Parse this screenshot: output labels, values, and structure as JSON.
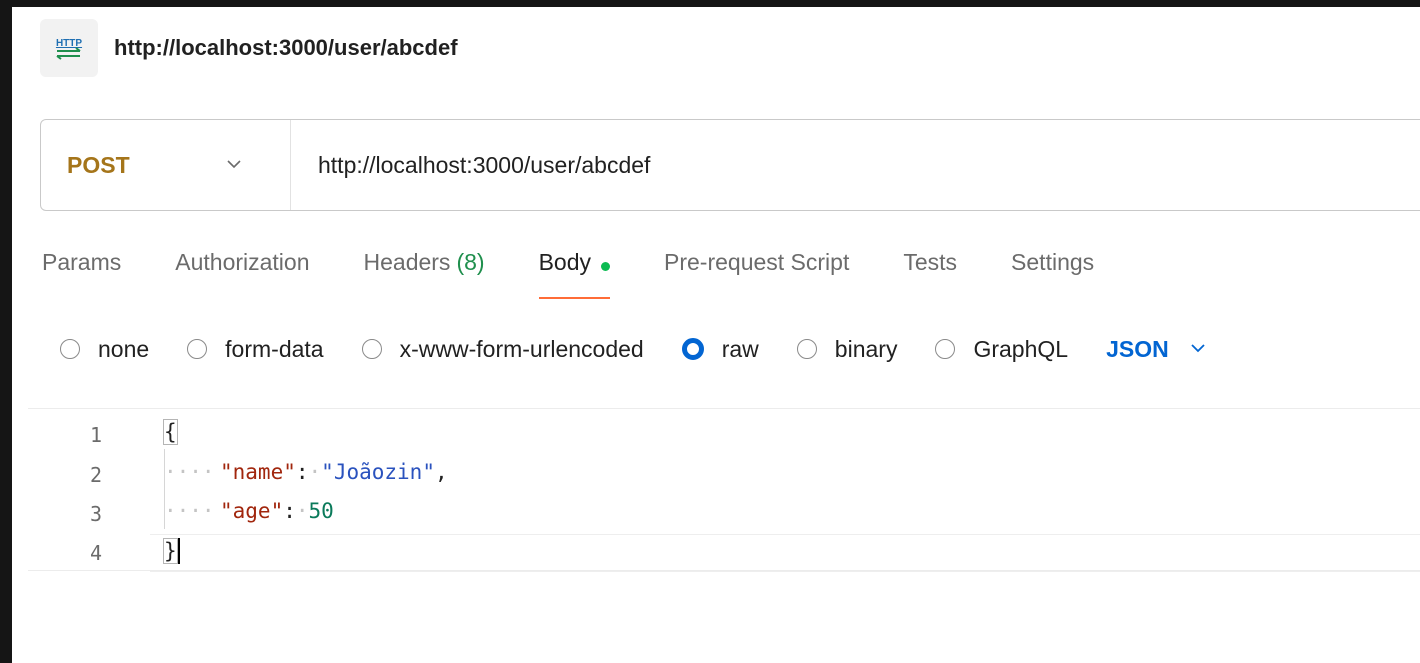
{
  "header": {
    "icon": "http-icon",
    "badge_text": "HTTP",
    "title": "http://localhost:3000/user/abcdef"
  },
  "request": {
    "method": "POST",
    "url": "http://localhost:3000/user/abcdef"
  },
  "tabs": [
    {
      "label": "Params"
    },
    {
      "label": "Authorization"
    },
    {
      "label": "Headers",
      "count": "(8)"
    },
    {
      "label": "Body",
      "active": true
    },
    {
      "label": "Pre-request Script"
    },
    {
      "label": "Tests"
    },
    {
      "label": "Settings"
    }
  ],
  "body_types": [
    {
      "label": "none",
      "checked": false
    },
    {
      "label": "form-data",
      "checked": false
    },
    {
      "label": "x-www-form-urlencoded",
      "checked": false
    },
    {
      "label": "raw",
      "checked": true
    },
    {
      "label": "binary",
      "checked": false
    },
    {
      "label": "GraphQL",
      "checked": false
    }
  ],
  "language": "JSON",
  "editor": {
    "line_numbers": [
      "1",
      "2",
      "3",
      "4"
    ],
    "open_brace": "{",
    "close_brace": "}",
    "name_key": "\"name\"",
    "name_value": "\"Joãozin\"",
    "age_key": "\"age\"",
    "age_value": "50",
    "colon": ":",
    "comma": ","
  },
  "colors": {
    "method": "#a5751a",
    "accent_tab": "#ff6c37",
    "body_dot": "#0cbb52",
    "radio_checked": "#0265d2",
    "json_key": "#a1260d",
    "json_string": "#2a52be",
    "json_number": "#0a7a5a"
  }
}
